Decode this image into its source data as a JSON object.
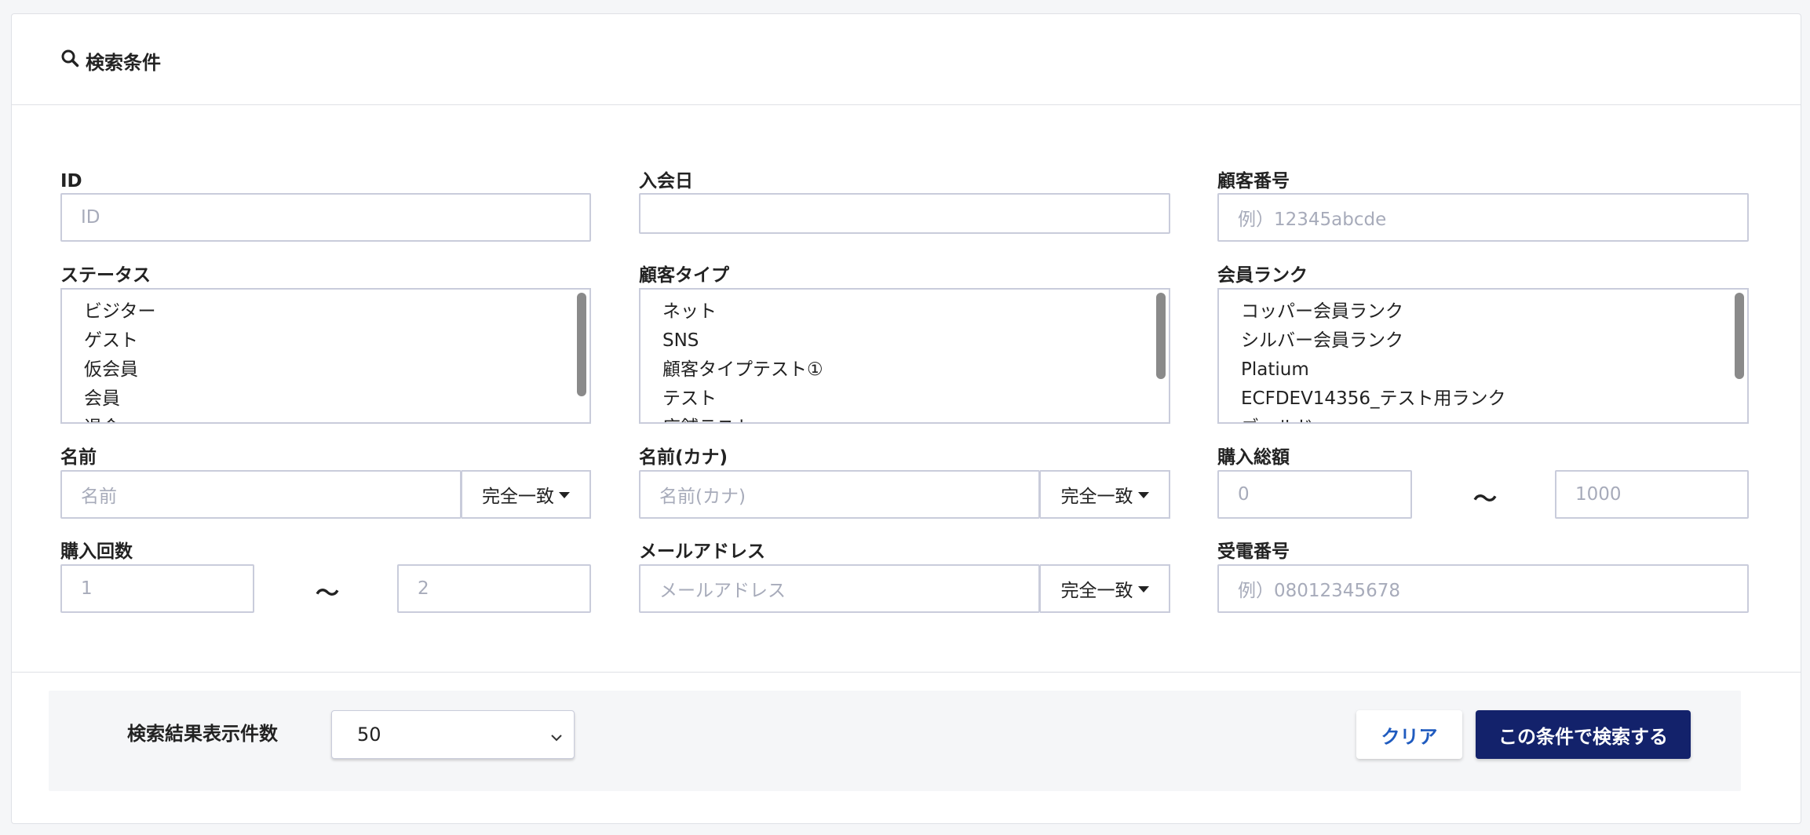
{
  "header": {
    "title": "検索条件",
    "icon": "search-icon"
  },
  "fields": {
    "id": {
      "label": "ID",
      "placeholder": "ID"
    },
    "join_date": {
      "label": "入会日",
      "value": ""
    },
    "customer_number": {
      "label": "顧客番号",
      "placeholder": "例）12345abcde"
    },
    "status": {
      "label": "ステータス",
      "options": [
        "ビジター",
        "ゲスト",
        "仮会員",
        "会員",
        "退会"
      ]
    },
    "customer_type": {
      "label": "顧客タイプ",
      "options": [
        "ネット",
        "SNS",
        "顧客タイプテスト①",
        "テスト",
        "店舗テスト"
      ]
    },
    "member_rank": {
      "label": "会員ランク",
      "options": [
        "コッパー会員ランク",
        "シルバー会員ランク",
        "Platium",
        "ECFDEV14356_テスト用ランク",
        "ゴールド"
      ]
    },
    "name": {
      "label": "名前",
      "placeholder": "名前",
      "match": "完全一致"
    },
    "name_kana": {
      "label": "名前(カナ)",
      "placeholder": "名前(カナ)",
      "match": "完全一致"
    },
    "purchase_total": {
      "label": "購入総額",
      "min_placeholder": "0",
      "max_placeholder": "1000",
      "separator": "〜"
    },
    "purchase_count": {
      "label": "購入回数",
      "min_placeholder": "1",
      "max_placeholder": "2",
      "separator": "〜"
    },
    "email": {
      "label": "メールアドレス",
      "placeholder": "メールアドレス",
      "match": "完全一致"
    },
    "phone": {
      "label": "受電番号",
      "placeholder": "例）08012345678"
    }
  },
  "footer": {
    "results_label": "検索結果表示件数",
    "results_value": "50",
    "clear_label": "クリア",
    "search_label": "この条件で検索する"
  },
  "colors": {
    "primary": "#13226b",
    "link": "#1f5bbf",
    "border": "#c9ccdb",
    "placeholder": "#a7abba"
  }
}
